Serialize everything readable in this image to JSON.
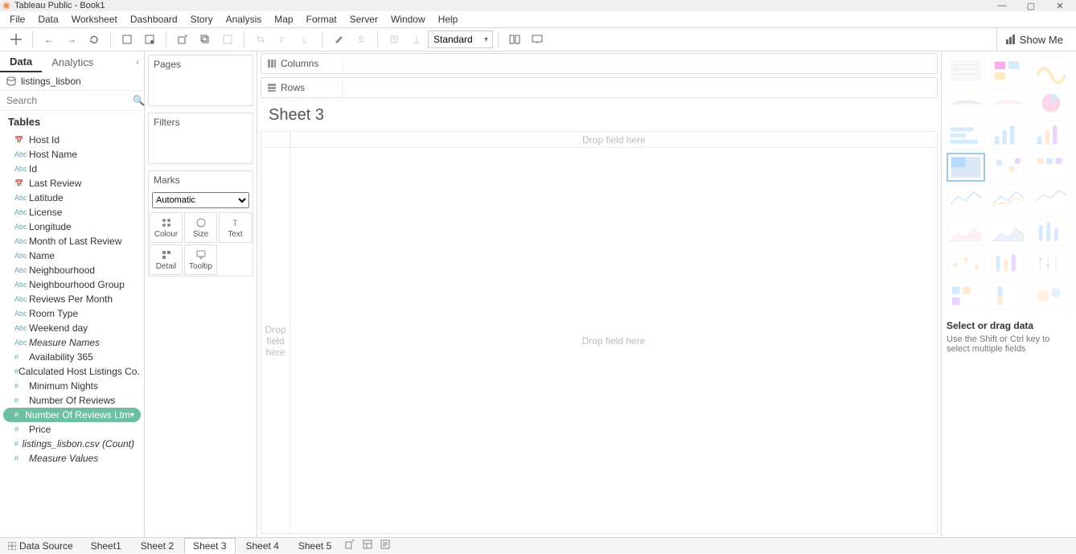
{
  "window": {
    "title": "Tableau Public - Book1"
  },
  "menu": [
    "File",
    "Data",
    "Worksheet",
    "Dashboard",
    "Story",
    "Analysis",
    "Map",
    "Format",
    "Server",
    "Window",
    "Help"
  ],
  "toolbar": {
    "fit": "Standard",
    "showme_label": "Show Me"
  },
  "data_pane": {
    "tabs": {
      "data": "Data",
      "analytics": "Analytics"
    },
    "datasource": "listings_lisbon",
    "search_placeholder": "Search",
    "tables_header": "Tables",
    "fields": [
      {
        "type": "date",
        "label": "Host Id"
      },
      {
        "type": "abc",
        "label": "Host Name"
      },
      {
        "type": "abc",
        "label": "Id"
      },
      {
        "type": "date",
        "label": "Last Review"
      },
      {
        "type": "abc",
        "label": "Latitude"
      },
      {
        "type": "abc",
        "label": "License"
      },
      {
        "type": "abc",
        "label": "Longitude"
      },
      {
        "type": "abc",
        "label": "Month of Last Review"
      },
      {
        "type": "abc",
        "label": "Name"
      },
      {
        "type": "abc",
        "label": "Neighbourhood"
      },
      {
        "type": "abc",
        "label": "Neighbourhood Group"
      },
      {
        "type": "abc",
        "label": "Reviews Per Month"
      },
      {
        "type": "abc",
        "label": "Room Type"
      },
      {
        "type": "abc",
        "label": "Weekend day"
      },
      {
        "type": "abc",
        "label": "Measure Names",
        "italic": true
      },
      {
        "type": "num",
        "label": "Availability 365"
      },
      {
        "type": "num",
        "label": "Calculated Host Listings Co..."
      },
      {
        "type": "num",
        "label": "Minimum Nights"
      },
      {
        "type": "num",
        "label": "Number Of Reviews"
      },
      {
        "type": "num",
        "label": "Number Of Reviews Ltm",
        "highlight": true
      },
      {
        "type": "num",
        "label": "Price"
      },
      {
        "type": "num",
        "label": "listings_lisbon.csv (Count)",
        "italic": true
      },
      {
        "type": "num",
        "label": "Measure Values",
        "italic": true
      }
    ]
  },
  "shelves": {
    "pages": "Pages",
    "filters": "Filters",
    "marks": "Marks",
    "mark_type": "Automatic",
    "mark_cells": [
      "Colour",
      "Size",
      "Text",
      "Detail",
      "Tooltip"
    ],
    "columns": "Columns",
    "rows": "Rows"
  },
  "sheet": {
    "title": "Sheet 3",
    "drop_top": "Drop field here",
    "drop_left": "Drop\nfield\nhere",
    "drop_center": "Drop field here"
  },
  "showme": {
    "hint_bold": "Select or drag data",
    "hint_sub": "Use the Shift or Ctrl key to select multiple fields"
  },
  "bottom_tabs": {
    "datasource": "Data Source",
    "sheets": [
      "Sheet1",
      "Sheet 2",
      "Sheet 3",
      "Sheet 4",
      "Sheet 5"
    ],
    "active": "Sheet 3"
  }
}
